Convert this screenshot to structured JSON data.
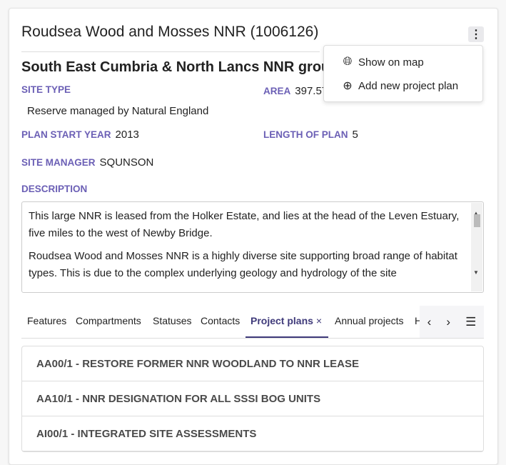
{
  "header": {
    "title": "Roudsea Wood and Mosses NNR (1006126)",
    "subtitle": "South East Cumbria & North Lancs NNR group"
  },
  "menu": {
    "items": [
      {
        "label": "Show on map",
        "icon": "globe-icon"
      },
      {
        "label": "Add new project plan",
        "icon": "plus-circle-icon"
      }
    ]
  },
  "fields": {
    "site_type_label": "SITE TYPE",
    "site_type": "Reserve managed by Natural England",
    "area_label": "AREA",
    "area": "397.57",
    "plan_start_label": "PLAN START YEAR",
    "plan_start": "2013",
    "length_label": "LENGTH OF PLAN",
    "length": "5",
    "manager_label": "SITE MANAGER",
    "manager": "SQUNSON",
    "description_label": "DESCRIPTION",
    "description": [
      "This large NNR is leased from the Holker Estate, and lies at the head of the Leven Estuary, five miles to the west of Newby Bridge.",
      "Roudsea Wood and Mosses NNR is a highly diverse site supporting broad range of habitat types. This is due to the complex underlying geology and hydrology of the site"
    ]
  },
  "tabs": {
    "items": [
      "Features",
      "Compartments",
      "Statuses",
      "Contacts",
      "Project plans",
      "Annual projects",
      "H"
    ],
    "active": "Project plans",
    "close": "×"
  },
  "project_plans": [
    "AA00/1 - RESTORE FORMER NNR WOODLAND TO NNR LEASE",
    "AA10/1 - NNR DESIGNATION FOR ALL SSSI BOG UNITS",
    "AI00/1 - INTEGRATED SITE ASSESSMENTS"
  ],
  "colors": {
    "label": "#6b5fb5",
    "active_tab": "#3f3a7a"
  }
}
